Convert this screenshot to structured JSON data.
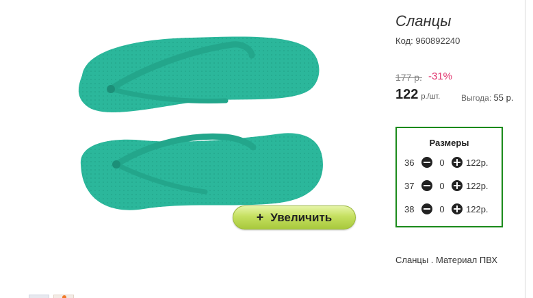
{
  "product": {
    "title": "Сланцы",
    "code_line": "Код: 960892240",
    "old_price": "177 р.",
    "discount": "-31%",
    "price": "122",
    "price_unit": "р./шт.",
    "savings_label": "Выгода:",
    "savings_value": "55 р.",
    "description": "Сланцы . Материал ПВХ"
  },
  "gallery": {
    "zoom_plus": "+",
    "zoom_label": "Увеличить",
    "item_color": "#2bb79b"
  },
  "sizes": {
    "title": "Размеры",
    "rows": [
      {
        "size": "36",
        "qty": "0",
        "price": "122р."
      },
      {
        "size": "37",
        "qty": "0",
        "price": "122р."
      },
      {
        "size": "38",
        "qty": "0",
        "price": "122р."
      }
    ]
  },
  "colors": {
    "sizes_border": "#1a8a1a",
    "discount": "#e0306a",
    "zoom_button": "#b8d84c"
  }
}
